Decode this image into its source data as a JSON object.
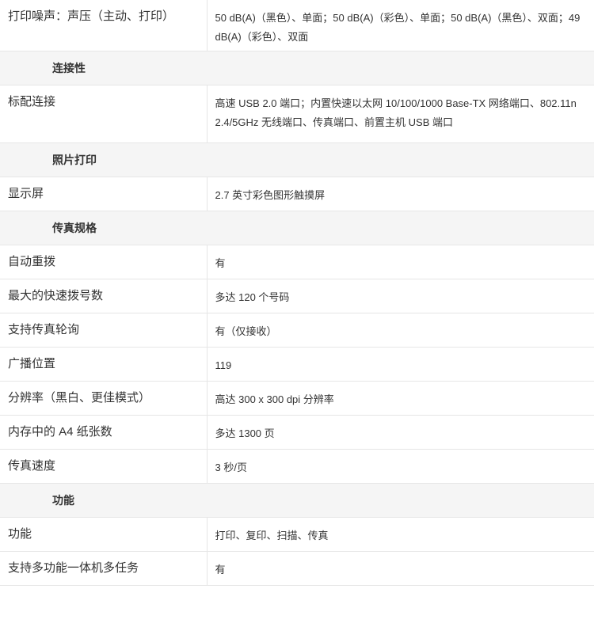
{
  "rows": [
    {
      "type": "row",
      "label": "打印噪声：声压（主动、打印）",
      "value": "50 dB(A)（黑色）、单面；50 dB(A)（彩色）、单面；50 dB(A)（黑色）、双面；49 dB(A)（彩色）、双面"
    },
    {
      "type": "section",
      "title": "连接性"
    },
    {
      "type": "row",
      "label": "标配连接",
      "value": "高速 USB 2.0 端口；内置快速以太网 10/100/1000 Base-TX 网络端口、802.11n 2.4/5GHz 无线端口、传真端口、前置主机 USB 端口"
    },
    {
      "type": "section",
      "title": "照片打印"
    },
    {
      "type": "row",
      "label": "显示屏",
      "value": "2.7 英寸彩色图形触摸屏"
    },
    {
      "type": "section",
      "title": "传真规格"
    },
    {
      "type": "row",
      "label": "自动重拨",
      "value": "有"
    },
    {
      "type": "row",
      "label": "最大的快速拨号数",
      "value": "多达 120 个号码"
    },
    {
      "type": "row",
      "label": "支持传真轮询",
      "value": "有（仅接收）"
    },
    {
      "type": "row",
      "label": "广播位置",
      "value": "119"
    },
    {
      "type": "row",
      "label": "分辨率（黑白、更佳模式）",
      "value": "高达 300 x 300 dpi 分辨率"
    },
    {
      "type": "row",
      "label": "内存中的 A4 纸张数",
      "value": "多达 1300 页"
    },
    {
      "type": "row",
      "label": "传真速度",
      "value": "3 秒/页"
    },
    {
      "type": "section",
      "title": "功能"
    },
    {
      "type": "row",
      "label": "功能",
      "value": "打印、复印、扫描、传真"
    },
    {
      "type": "row",
      "label": "支持多功能一体机多任务",
      "value": "有"
    }
  ]
}
